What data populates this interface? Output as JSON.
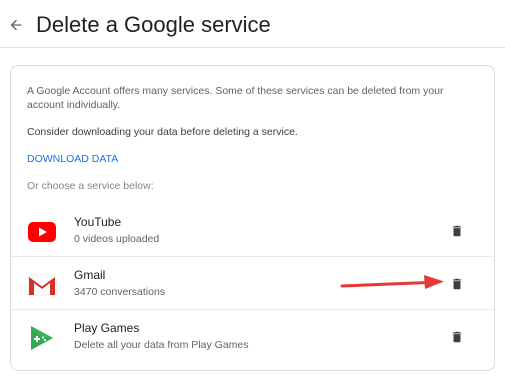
{
  "header": {
    "back_icon": "arrow-back-icon",
    "title": "Delete a Google service"
  },
  "card": {
    "intro": "A Google Account offers many services. Some of these services can be deleted from your account individually.",
    "consider": "Consider downloading your data before deleting a service.",
    "download_label": "DOWNLOAD DATA",
    "choose_label": "Or choose a service below:",
    "services": [
      {
        "name": "YouTube",
        "description": "0 videos uploaded",
        "icon": "youtube-icon",
        "action_icon": "trash-icon"
      },
      {
        "name": "Gmail",
        "description": "3470 conversations",
        "icon": "gmail-icon",
        "action_icon": "trash-icon"
      },
      {
        "name": "Play Games",
        "description": "Delete all your data from Play Games",
        "icon": "play-games-icon",
        "action_icon": "trash-icon"
      }
    ]
  },
  "colors": {
    "link": "#1a73e8",
    "annotation_arrow": "#e53935",
    "youtube_red": "#ff0000",
    "gmail_red": "#d93025",
    "play_games_green": "#34a853"
  }
}
